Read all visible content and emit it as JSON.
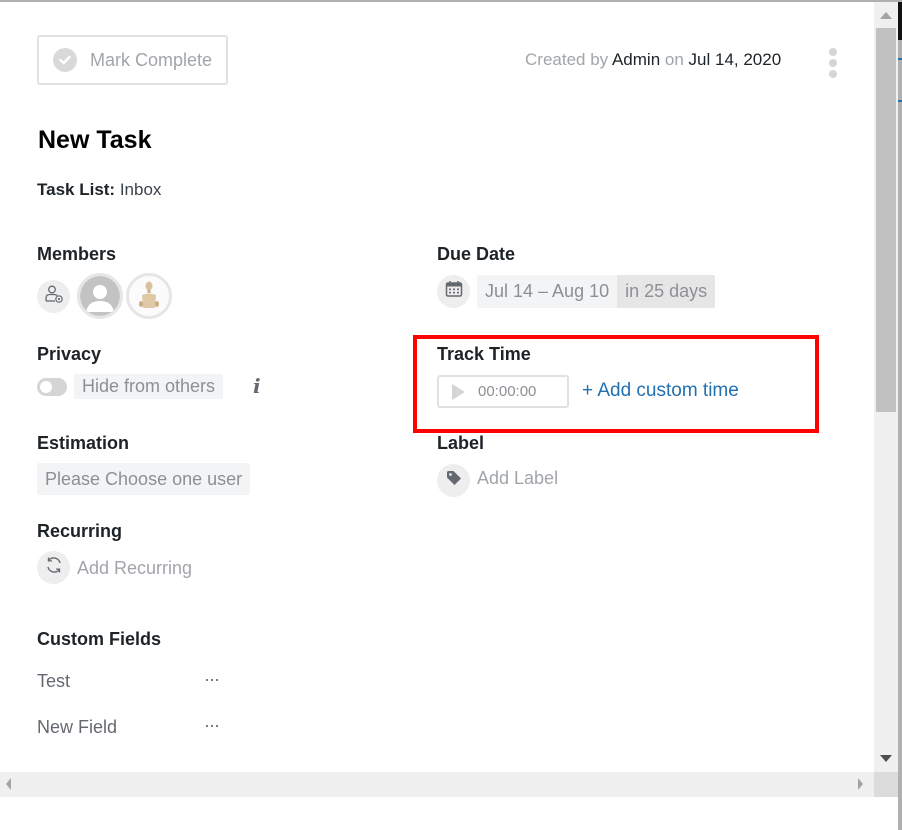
{
  "header": {
    "mark_complete_label": "Mark Complete",
    "created_prefix": "Created by",
    "created_by": "Admin",
    "created_on_word": "on",
    "created_date": "Jul 14, 2020"
  },
  "task": {
    "title": "New Task",
    "task_list_label": "Task List:",
    "task_list_value": "Inbox"
  },
  "fields": {
    "members": {
      "label": "Members",
      "avatars": [
        {
          "name": "default-user-avatar"
        },
        {
          "name": "wooden-mannequin-avatar"
        }
      ]
    },
    "privacy": {
      "label": "Privacy",
      "toggle_on": false,
      "toggle_text": "Hide from others",
      "info_glyph": "i"
    },
    "estimation": {
      "label": "Estimation",
      "value": "Please Choose one user"
    },
    "recurring": {
      "label": "Recurring",
      "action": "Add Recurring"
    },
    "due_date": {
      "label": "Due Date",
      "range": "Jul 14 – Aug 10",
      "relative": "in 25 days"
    },
    "track_time": {
      "label": "Track Time",
      "timer_value": "00:00:00",
      "add_custom_label": "+ Add custom time"
    },
    "label": {
      "label": "Label",
      "action": "Add Label"
    }
  },
  "custom_fields": {
    "heading": "Custom Fields",
    "items": [
      {
        "name": "Test",
        "menu": "···"
      },
      {
        "name": "New Field",
        "menu": "···"
      }
    ]
  },
  "colors": {
    "link": "#2271b1",
    "highlight": "#ff0000",
    "muted_text": "#a1a5aa",
    "heading_text": "#1d2327"
  }
}
